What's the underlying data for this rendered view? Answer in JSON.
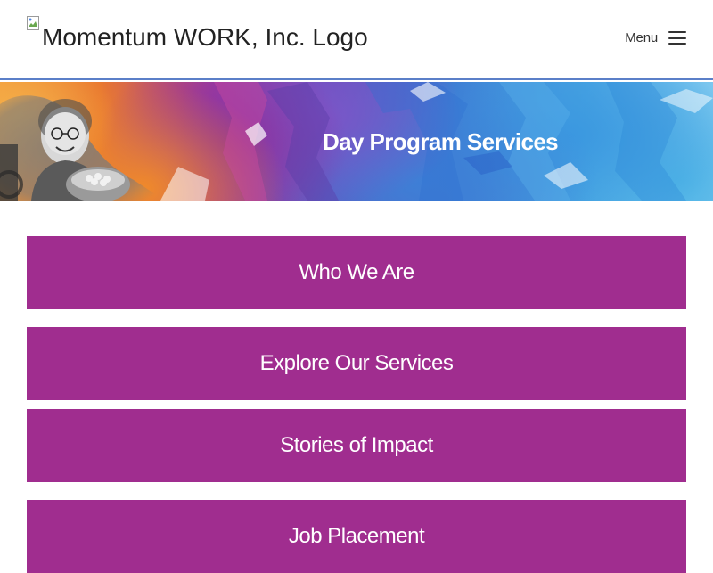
{
  "header": {
    "logo_alt": "Momentum WORK, Inc. Logo",
    "menu_label": "Menu"
  },
  "hero": {
    "title": "Day Program Services"
  },
  "nav": {
    "items": [
      {
        "label": "Who We Are"
      },
      {
        "label": "Explore Our Services"
      },
      {
        "label": "Stories of Impact"
      },
      {
        "label": "Job Placement"
      }
    ]
  },
  "colors": {
    "accent_purple": "#a02d8f",
    "header_border": "#5b7fc8",
    "text_dark": "#222222"
  }
}
